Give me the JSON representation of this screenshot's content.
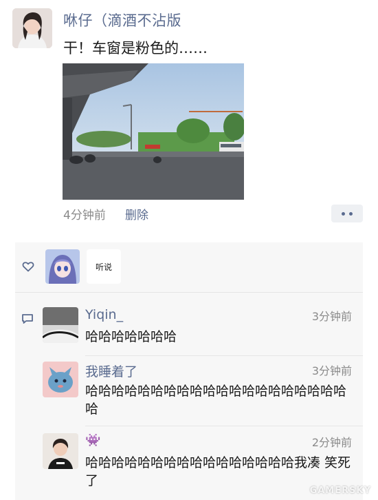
{
  "post": {
    "author": "咻仔（滴酒不沾版",
    "text": "干！车窗是粉色的……",
    "time": "4分钟前",
    "delete_label": "删除"
  },
  "likes": {
    "second_avatar_text": "听说"
  },
  "comments": [
    {
      "name": "Yiqin_",
      "time": "3分钟前",
      "text": "哈哈哈哈哈哈哈"
    },
    {
      "name": "我睡着了",
      "time": "3分钟前",
      "text": "哈哈哈哈哈哈哈哈哈哈哈哈哈哈哈哈哈哈哈哈哈"
    },
    {
      "name": "👾",
      "time": "2分钟前",
      "text": "哈哈哈哈哈哈哈哈哈哈哈哈哈哈哈哈我凑 笑死了"
    }
  ],
  "watermark": "GAMERSKY",
  "colors": {
    "name_link": "#5a6b8f",
    "panel_bg": "#f7f7f7"
  }
}
